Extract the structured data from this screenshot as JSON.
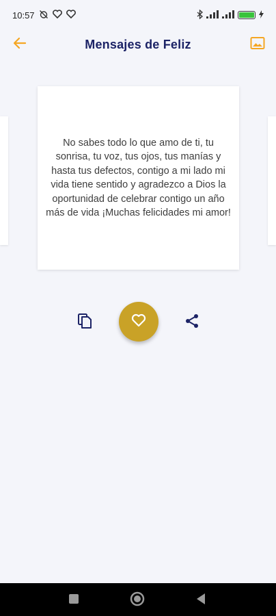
{
  "status_bar": {
    "time": "10:57"
  },
  "header": {
    "title": "Mensajes de Feliz",
    "back_icon": "arrow-left-icon",
    "gallery_icon": "image-icon",
    "accent_color": "#f5a623",
    "title_color": "#1c2366"
  },
  "card": {
    "message": "No sabes todo lo que amo de ti, tu sonrisa, tu voz, tus ojos, tus manías y hasta tus defectos, contigo a mi lado mi vida tiene sentido y agradezco a Dios la oportunidad de celebrar contigo un año más de vida ¡Muchas felicidades mi amor!"
  },
  "actions": {
    "copy_icon": "copy-icon",
    "favorite_icon": "heart-icon",
    "share_icon": "share-icon",
    "favorite_color": "#c9a227"
  },
  "navigation": {
    "recents_icon": "square-icon",
    "home_icon": "circle-icon",
    "back_icon": "triangle-back-icon"
  }
}
